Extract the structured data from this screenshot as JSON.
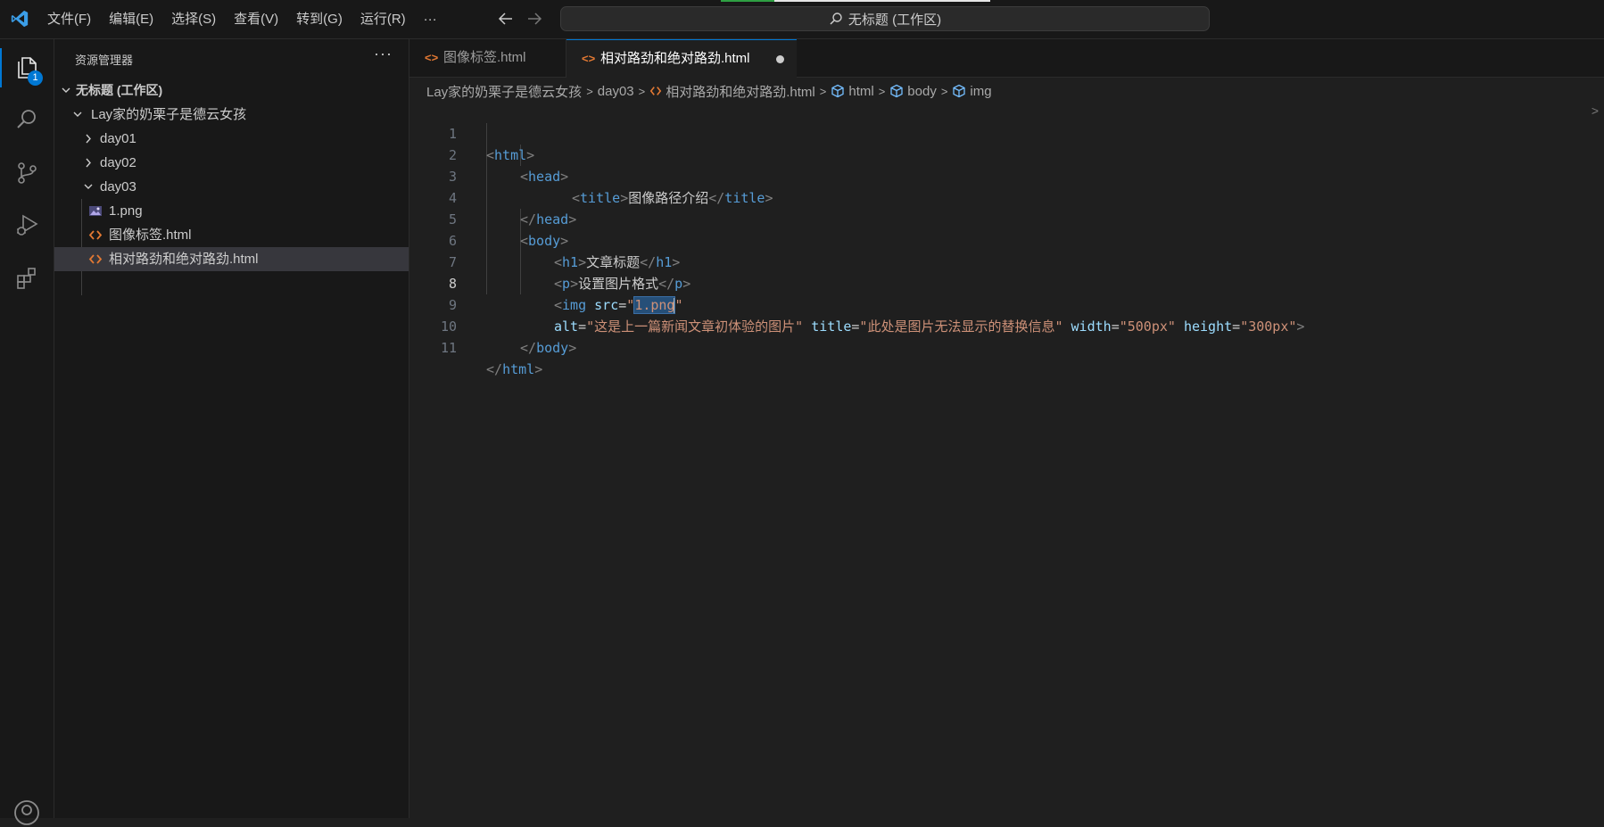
{
  "window": {
    "command_center": "无标题 (工作区)"
  },
  "menu": [
    "文件(F)",
    "编辑(E)",
    "选择(S)",
    "查看(V)",
    "转到(G)",
    "运行(R)",
    "···"
  ],
  "activity": {
    "explorer_badge": "1"
  },
  "sidebar": {
    "title": "资源管理器",
    "more": "···",
    "tree": [
      {
        "label": "无标题 (工作区)"
      },
      {
        "label": "Lay家的奶栗子是德云女孩"
      },
      {
        "label": "day01"
      },
      {
        "label": "day02"
      },
      {
        "label": "day03"
      },
      {
        "label": "1.png"
      },
      {
        "label": "图像标签.html"
      },
      {
        "label": "相对路劲和绝对路劲.html"
      }
    ]
  },
  "tabs": [
    {
      "label": "图像标签.html"
    },
    {
      "label": "相对路劲和绝对路劲.html"
    }
  ],
  "breadcrumb": [
    "Lay家的奶栗子是德云女孩",
    "day03",
    "相对路劲和绝对路劲.html",
    "html",
    "body",
    "img"
  ],
  "editor": {
    "line_numbers": [
      "1",
      "2",
      "3",
      "4",
      "5",
      "6",
      "7",
      "8",
      "9",
      "10",
      "11"
    ],
    "l1": {
      "tag": "html"
    },
    "l2": {
      "tag": "head"
    },
    "l3": {
      "tag": "title",
      "text": "图像路径介绍"
    },
    "l4": {
      "tag": "head"
    },
    "l5": {
      "tag": "body"
    },
    "l6": {
      "tag": "h1",
      "text": "文章标题"
    },
    "l7": {
      "tag": "p",
      "text": "设置图片格式"
    },
    "l8": {
      "tag": "img",
      "attr": "src",
      "value": "1.png"
    },
    "l9": {
      "alt_attr": "alt",
      "alt_value": "这是上一篇新闻文章初体验的图片",
      "title_attr": "title",
      "title_value": "此处是图片无法显示的替换信息",
      "width_attr": "width",
      "width_value": "500px",
      "height_attr": "height",
      "height_value": "300px"
    },
    "l10": {
      "tag": "body"
    },
    "l11": {
      "tag": "html"
    }
  },
  "colors": {
    "accent": "#0078d4",
    "tag": "#569cd6",
    "attr": "#9cdcfe",
    "string": "#ce9178",
    "html_icon": "#e37933"
  }
}
